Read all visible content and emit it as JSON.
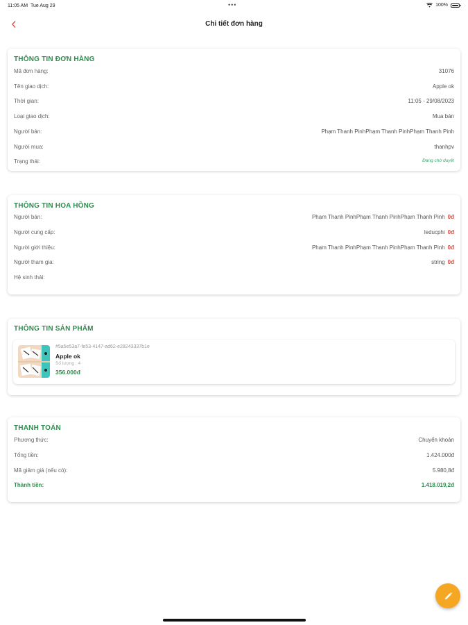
{
  "status_bar": {
    "time": "11:05 AM",
    "date": "Tue Aug 29",
    "dots": "•••",
    "battery": "100%"
  },
  "header": {
    "title": "Chi tiết đơn hàng"
  },
  "order_info": {
    "title": "THÔNG TIN ĐƠN HÀNG",
    "rows": [
      {
        "label": "Mã đơn hàng:",
        "value": "31076"
      },
      {
        "label": "Tên giao dịch:",
        "value": "Apple ok"
      },
      {
        "label": "Thời gian:",
        "value": "11:05 - 29/08/2023"
      },
      {
        "label": "Loại giao dịch:",
        "value": "Mua bán"
      },
      {
        "label": "Người bán:",
        "value": "Phạm Thanh PinhPhạm Thanh PinhPhạm Thanh Pinh"
      },
      {
        "label": "Người mua:",
        "value": "thanhpv"
      },
      {
        "label": "Trạng thái:",
        "value": "Đang chờ duyệt"
      }
    ]
  },
  "commission_info": {
    "title": "THÔNG TIN HOA HỒNG",
    "rows": [
      {
        "label": "Người bán:",
        "value": "Phạm Thanh PinhPhạm Thanh PinhPhạm Thanh Pinh",
        "amount": "0đ"
      },
      {
        "label": "Người cung cấp:",
        "value": "leducphi",
        "amount": "0đ"
      },
      {
        "label": "Người giới thiệu:",
        "value": "Phạm Thanh PinhPhạm Thanh PinhPhạm Thanh Pinh",
        "amount": "0đ"
      },
      {
        "label": "Người tham gia:",
        "value": "string",
        "amount": "0đ"
      },
      {
        "label": "Hệ sinh thái:",
        "value": "",
        "amount": ""
      }
    ]
  },
  "product_info": {
    "title": "THÔNG TIN SẢN PHẨM",
    "product": {
      "id": "#5a5e53a7-fe53-4147-ad62-e28243337b1e",
      "name": "Apple ok",
      "quantity": "Số lượng : 4",
      "price": "356.000đ"
    }
  },
  "payment": {
    "title": "THANH TOÁN",
    "rows": [
      {
        "label": "Phương thức:",
        "value": "Chuyển khoản"
      },
      {
        "label": "Tổng tiền:",
        "value": "1.424.000đ"
      },
      {
        "label": "Mã giảm giá (nếu có):",
        "value": "5.980,8đ"
      },
      {
        "label": "Thành tiền:",
        "value": "1.418.019,2đ"
      }
    ]
  },
  "colors": {
    "accent_green": "#2e8b4e",
    "red": "#e2463a",
    "fab": "#f5a623"
  },
  "icons": {
    "back": "chevron-left-icon",
    "fab": "pencil-icon"
  }
}
